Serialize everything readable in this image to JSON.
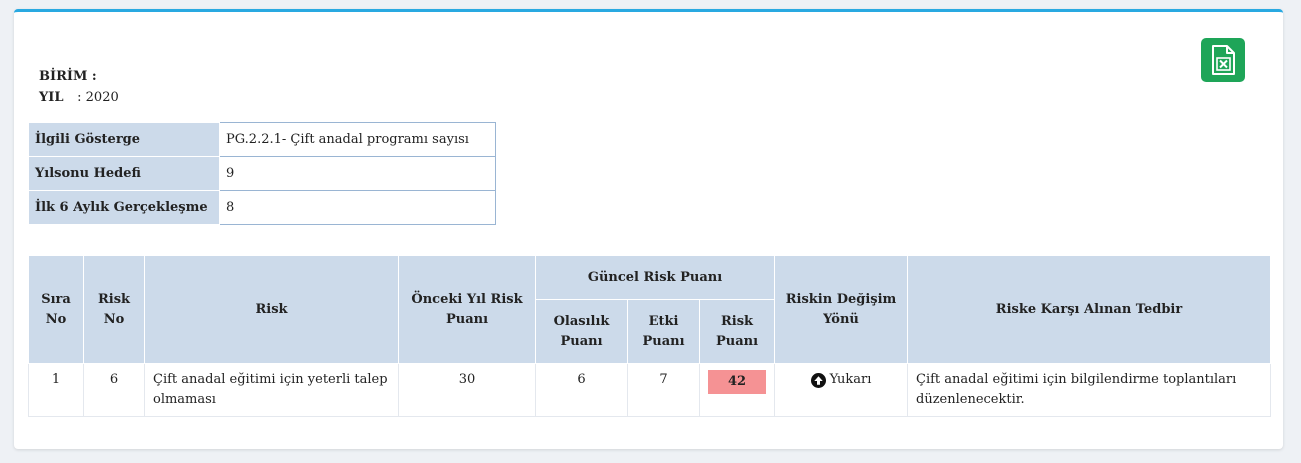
{
  "meta": {
    "unit_label": "BİRİM :",
    "unit_value": "",
    "year_label": "YIL",
    "year_value": ": 2020"
  },
  "export": {
    "icon": "excel-export-icon",
    "color": "#1ea558"
  },
  "info": [
    {
      "key": "İlgili Gösterge",
      "value": "PG.2.2.1- Çift anadal programı sayısı"
    },
    {
      "key": "Yılsonu Hedefi",
      "value": "9"
    },
    {
      "key": "İlk 6 Aylık Gerçekleşme",
      "value": "8"
    }
  ],
  "table": {
    "headers": {
      "sira_no": "Sıra No",
      "risk_no": "Risk No",
      "risk": "Risk",
      "onceki": "Önceki Yıl Risk Puanı",
      "guncel": "Güncel Risk Puanı",
      "olasilik": "Olasılık Puanı",
      "etki": "Etki Puanı",
      "risk_puani": "Risk Puanı",
      "degisim": "Riskin Değişim Yönü",
      "tedbir": "Riske Karşı Alınan Tedbir"
    },
    "rows": [
      {
        "sira": "1",
        "risk_no": "6",
        "risk": "Çift anadal eğitimi için yeterli talep olmaması",
        "onceki": "30",
        "olasilik": "6",
        "etki": "7",
        "risk_puani": "42",
        "degisim": "Yukarı",
        "degisim_icon": "arrow-up-circle-icon",
        "tedbir": "Çift anadal eğitimi için bilgilendirme toplantıları düzenlenecektir."
      }
    ]
  },
  "colors": {
    "accent": "#29a9e1",
    "header_bg": "#ccdaea",
    "score_high": "#f59294"
  }
}
